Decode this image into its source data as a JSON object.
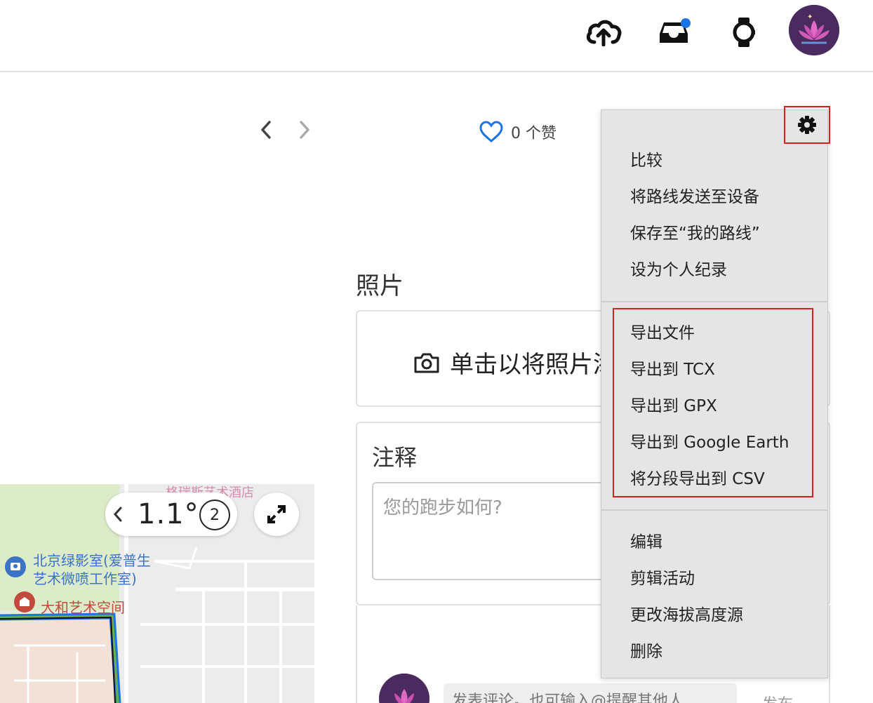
{
  "header": {
    "icons": [
      "upload-cloud-icon",
      "inbox-icon",
      "watch-icon"
    ],
    "notification_dot_color": "#1a74e6"
  },
  "activity": {
    "likes_label": "0 个赞"
  },
  "photos": {
    "title": "照片",
    "upload_label": "单击以将照片添"
  },
  "notes": {
    "title": "注释",
    "placeholder": "您的跑步如何?"
  },
  "comment": {
    "placeholder": "发表评论。也可输入@提醒其他人",
    "post_label": "发布"
  },
  "map": {
    "zoom_value": "1.1°",
    "badge_value": "2",
    "poi_1": "北京绿影室(爱普生",
    "poi_1b": "艺术微喷工作室)",
    "poi_2": "大和艺术空间",
    "poi_top": "格瑞斯艺术酒店"
  },
  "menu": {
    "group1": [
      "比较",
      "将路线发送至设备",
      "保存至“我的路线”",
      "设为个人纪录"
    ],
    "group2": [
      "导出文件",
      "导出到 TCX",
      "导出到 GPX",
      "导出到 Google Earth",
      "将分段导出到 CSV"
    ],
    "group3": [
      "编辑",
      "剪辑活动",
      "更改海拔高度源",
      "删除"
    ]
  },
  "colors": {
    "accent": "#1a74e6",
    "highlight_border": "#d62020",
    "menu_bg": "#e5e5e5"
  }
}
